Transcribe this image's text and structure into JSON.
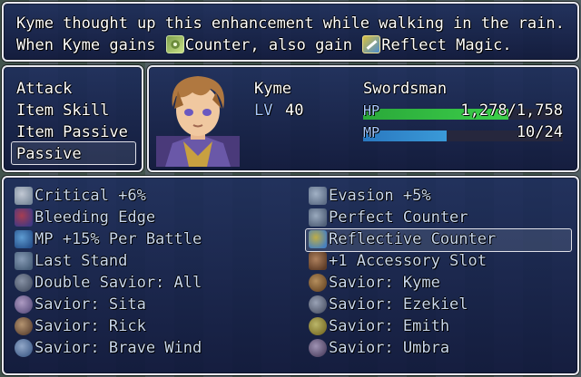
{
  "help": {
    "line1": "Kyme thought up this enhancement while walking in the rain.",
    "line2_prefix": "When Kyme gains ",
    "line2_counter": "Counter",
    "line2_mid": ", also gain ",
    "line2_reflect": "Reflect Magic",
    "line2_suffix": ".",
    "counter_icon": "counter-icon",
    "reflect_icon": "reflect-magic-icon"
  },
  "commands": {
    "items": [
      "Attack",
      "Item Skill",
      "Item Passive",
      "Passive"
    ],
    "selected": "Passive"
  },
  "actor": {
    "name": "Kyme",
    "level_label": "LV",
    "level": "40",
    "class": "Swordsman",
    "hp_label": "HP",
    "hp": "1,278/1,758",
    "hp_ratio": 0.727,
    "mp_label": "MP",
    "mp": "10/24",
    "mp_ratio": 0.417,
    "portrait_icon": "character-portrait"
  },
  "skills": {
    "left": [
      {
        "label": "Critical +6%",
        "icon": "star-burst-icon"
      },
      {
        "label": "Bleeding Edge",
        "icon": "blood-blade-icon"
      },
      {
        "label": "MP +15% Per Battle",
        "icon": "mana-crystal-icon"
      },
      {
        "label": "Last Stand",
        "icon": "shield-stand-icon"
      },
      {
        "label": "Double Savior: All",
        "icon": "savior-icon"
      },
      {
        "label": "Savior: Sita",
        "icon": "savior-sita-icon"
      },
      {
        "label": "Savior: Rick",
        "icon": "savior-rick-icon"
      },
      {
        "label": "Savior: Brave Wind",
        "icon": "savior-brave-wind-icon"
      }
    ],
    "right": [
      {
        "label": "Evasion +5%",
        "icon": "evasion-icon"
      },
      {
        "label": "Perfect Counter",
        "icon": "counter-icon"
      },
      {
        "label": "Reflective Counter",
        "icon": "reflect-magic-icon"
      },
      {
        "label": "+1 Accessory Slot",
        "icon": "accessory-icon"
      },
      {
        "label": "Savior: Kyme",
        "icon": "savior-kyme-icon"
      },
      {
        "label": "Savior: Ezekiel",
        "icon": "savior-ezekiel-icon"
      },
      {
        "label": "Savior: Emith",
        "icon": "savior-emith-icon"
      },
      {
        "label": "Savior: Umbra",
        "icon": "savior-umbra-icon"
      }
    ],
    "selected": "Reflective Counter"
  },
  "colors": {
    "hp_fill": "#3ccf4a",
    "mp_fill": "#3a9ad8",
    "window_bg": "#1c2c5c",
    "skill_text": "#c9d8ee"
  }
}
